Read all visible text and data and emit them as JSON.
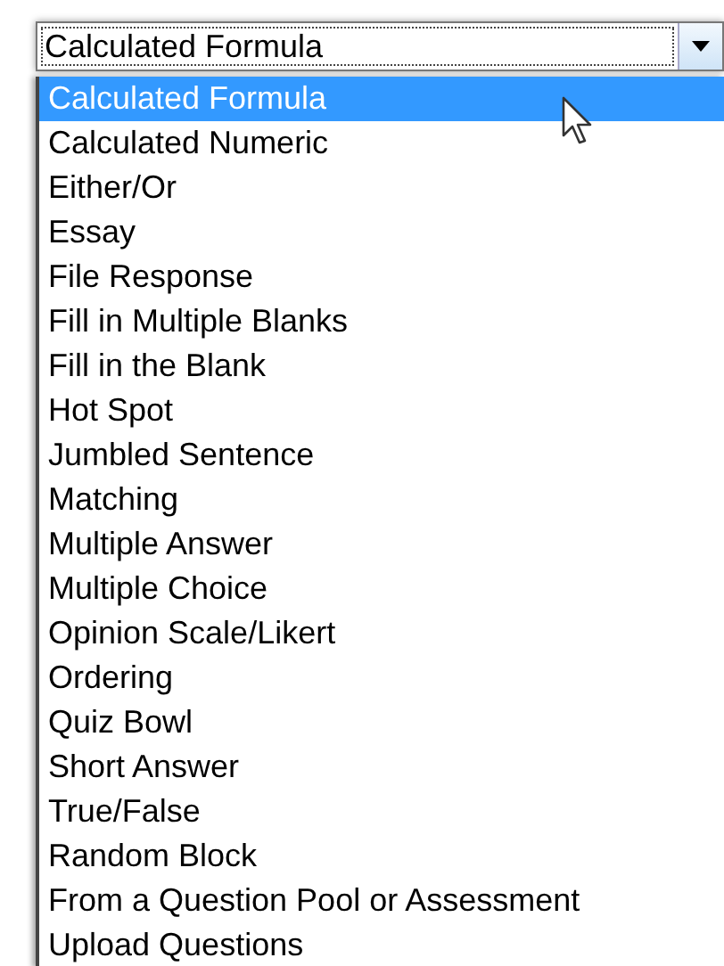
{
  "dropdown": {
    "value": "Calculated Formula",
    "options": [
      {
        "label": "Calculated Formula",
        "selected": true
      },
      {
        "label": "Calculated Numeric",
        "selected": false
      },
      {
        "label": "Either/Or",
        "selected": false
      },
      {
        "label": "Essay",
        "selected": false
      },
      {
        "label": "File Response",
        "selected": false
      },
      {
        "label": "Fill in Multiple Blanks",
        "selected": false
      },
      {
        "label": "Fill in the Blank",
        "selected": false
      },
      {
        "label": "Hot Spot",
        "selected": false
      },
      {
        "label": "Jumbled Sentence",
        "selected": false
      },
      {
        "label": "Matching",
        "selected": false
      },
      {
        "label": "Multiple Answer",
        "selected": false
      },
      {
        "label": "Multiple Choice",
        "selected": false
      },
      {
        "label": "Opinion Scale/Likert",
        "selected": false
      },
      {
        "label": "Ordering",
        "selected": false
      },
      {
        "label": "Quiz Bowl",
        "selected": false
      },
      {
        "label": "Short Answer",
        "selected": false
      },
      {
        "label": "True/False",
        "selected": false
      },
      {
        "label": "Random Block",
        "selected": false
      },
      {
        "label": "From a Question Pool or Assessment",
        "selected": false
      },
      {
        "label": "Upload Questions",
        "selected": false
      }
    ]
  }
}
